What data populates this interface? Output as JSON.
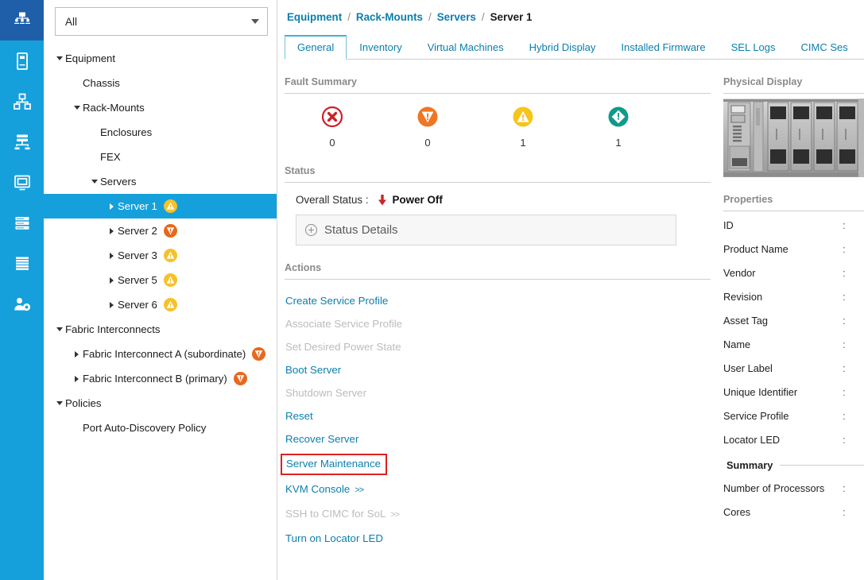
{
  "iconbar": {
    "items": [
      {
        "name": "equipment-icon",
        "active": true
      },
      {
        "name": "servers-icon",
        "active": false
      },
      {
        "name": "lan-icon",
        "active": false
      },
      {
        "name": "san-icon",
        "active": false
      },
      {
        "name": "vm-icon",
        "active": false
      },
      {
        "name": "storage-icon",
        "active": false
      },
      {
        "name": "chassis-icon",
        "active": false
      },
      {
        "name": "admin-icon",
        "active": false
      }
    ]
  },
  "filter": {
    "value": "All",
    "placeholder": "All"
  },
  "tree": {
    "items": [
      {
        "label": "Equipment",
        "indent": 0,
        "twisty": "down",
        "badge": "none",
        "selected": false
      },
      {
        "label": "Chassis",
        "indent": 1,
        "twisty": "none",
        "badge": "none",
        "selected": false
      },
      {
        "label": "Rack-Mounts",
        "indent": 1,
        "twisty": "down",
        "badge": "none",
        "selected": false
      },
      {
        "label": "Enclosures",
        "indent": 2,
        "twisty": "none",
        "badge": "none",
        "selected": false
      },
      {
        "label": "FEX",
        "indent": 2,
        "twisty": "none",
        "badge": "none",
        "selected": false
      },
      {
        "label": "Servers",
        "indent": 2,
        "twisty": "down",
        "badge": "none",
        "selected": false
      },
      {
        "label": "Server 1",
        "indent": 3,
        "twisty": "right",
        "badge": "warning",
        "selected": true
      },
      {
        "label": "Server 2",
        "indent": 3,
        "twisty": "right",
        "badge": "major",
        "selected": false
      },
      {
        "label": "Server 3",
        "indent": 3,
        "twisty": "right",
        "badge": "warning",
        "selected": false
      },
      {
        "label": "Server 5",
        "indent": 3,
        "twisty": "right",
        "badge": "warning",
        "selected": false
      },
      {
        "label": "Server 6",
        "indent": 3,
        "twisty": "right",
        "badge": "warning",
        "selected": false
      },
      {
        "label": "Fabric Interconnects",
        "indent": 0,
        "twisty": "down",
        "badge": "none",
        "selected": false
      },
      {
        "label": "Fabric Interconnect A (subordinate)",
        "indent": 1,
        "twisty": "right",
        "badge": "major",
        "selected": false
      },
      {
        "label": "Fabric Interconnect B (primary)",
        "indent": 1,
        "twisty": "right",
        "badge": "major",
        "selected": false
      },
      {
        "label": "Policies",
        "indent": 0,
        "twisty": "down",
        "badge": "none",
        "selected": false
      },
      {
        "label": "Port Auto-Discovery Policy",
        "indent": 1,
        "twisty": "none",
        "badge": "none",
        "selected": false
      }
    ]
  },
  "breadcrumb": {
    "items": [
      "Equipment",
      "Rack-Mounts",
      "Servers"
    ],
    "current": "Server 1",
    "separator": "/"
  },
  "tabs": {
    "items": [
      {
        "label": "General",
        "active": true
      },
      {
        "label": "Inventory",
        "active": false
      },
      {
        "label": "Virtual Machines",
        "active": false
      },
      {
        "label": "Hybrid Display",
        "active": false
      },
      {
        "label": "Installed Firmware",
        "active": false
      },
      {
        "label": "SEL Logs",
        "active": false
      },
      {
        "label": "CIMC Ses",
        "active": false
      }
    ]
  },
  "fault_summary": {
    "title": "Fault Summary",
    "counters": [
      {
        "severity": "critical",
        "icon": "critical-icon",
        "count": "0",
        "color": "#cf2029"
      },
      {
        "severity": "major",
        "icon": "major-icon",
        "count": "0",
        "color": "#ef7622"
      },
      {
        "severity": "minor",
        "icon": "warning-icon",
        "count": "1",
        "color": "#f5c518"
      },
      {
        "severity": "info",
        "icon": "info-icon",
        "count": "1",
        "color": "#0f9a8a"
      }
    ]
  },
  "status": {
    "title": "Status",
    "overall_label": "Overall Status :",
    "overall_value": "Power Off",
    "details_label": "Status Details"
  },
  "actions": {
    "title": "Actions",
    "items": [
      {
        "label": "Create Service Profile",
        "disabled": false,
        "chevron": false,
        "highlight": false
      },
      {
        "label": "Associate Service Profile",
        "disabled": true,
        "chevron": false,
        "highlight": false
      },
      {
        "label": "Set Desired Power State",
        "disabled": true,
        "chevron": false,
        "highlight": false
      },
      {
        "label": "Boot Server",
        "disabled": false,
        "chevron": false,
        "highlight": false
      },
      {
        "label": "Shutdown Server",
        "disabled": true,
        "chevron": false,
        "highlight": false
      },
      {
        "label": "Reset",
        "disabled": false,
        "chevron": false,
        "highlight": false
      },
      {
        "label": "Recover Server",
        "disabled": false,
        "chevron": false,
        "highlight": false
      },
      {
        "label": "Server Maintenance",
        "disabled": false,
        "chevron": false,
        "highlight": true
      },
      {
        "label": "KVM Console",
        "disabled": false,
        "chevron": true,
        "highlight": false
      },
      {
        "label": "SSH to CIMC for SoL",
        "disabled": true,
        "chevron": true,
        "highlight": false
      },
      {
        "label": "Turn on Locator LED",
        "disabled": false,
        "chevron": false,
        "highlight": false
      }
    ],
    "chevron_glyph": ">>"
  },
  "physical_display": {
    "title": "Physical Display"
  },
  "properties": {
    "title": "Properties",
    "colon": ":",
    "rows": [
      {
        "key": "ID"
      },
      {
        "key": "Product Name"
      },
      {
        "key": "Vendor"
      },
      {
        "key": "Revision"
      },
      {
        "key": "Asset Tag"
      },
      {
        "key": "Name"
      },
      {
        "key": "User Label"
      },
      {
        "key": "Unique Identifier"
      },
      {
        "key": "Service Profile"
      },
      {
        "key": "Locator LED"
      }
    ],
    "summary_title": "Summary",
    "summary_rows": [
      {
        "key": "Number of Processors"
      },
      {
        "key": "Cores"
      }
    ]
  },
  "colors": {
    "rail": "#15a0dc",
    "rail_active": "#1f5fa9",
    "link": "#0b7fad",
    "selection": "#15a0dc",
    "highlight_box": "#e02020"
  }
}
